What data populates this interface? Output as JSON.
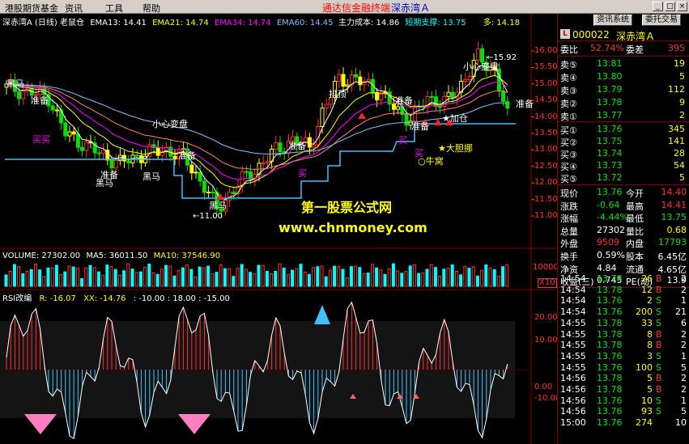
{
  "menu": {
    "items": [
      "港股期货基金",
      "资讯",
      "工具",
      "帮助"
    ],
    "ad": "通达信金融终端",
    "stock_title": "深赤湾Ａ"
  },
  "colors": {
    "up": "#ff3030",
    "down": "#00e000",
    "bg": "#000000",
    "grid": "#800000"
  },
  "main_header": {
    "name": "深赤湾A (日线) 老鼠仓",
    "ema13": "EMA13: 14.41",
    "ema21": "EMA21: 14.74",
    "ema34": "EMA34: 14.74",
    "ema60": "EMA60: 14.45",
    "cost": "主力成本: 14.86",
    "support": "短期支撑: 13.75",
    "duo": "多: 14.18"
  },
  "price_axis": [
    "16.00",
    "15.50",
    "15.00",
    "14.50",
    "14.00",
    "13.50",
    "13.00",
    "12.50",
    "12.00",
    "11.50",
    "11.00"
  ],
  "annotations": {
    "heima1": "黑马",
    "zhunbei1": "准备",
    "maimai": "买买",
    "zhunbei2": "准备",
    "heima2": "黑马",
    "heima3": "黑马",
    "xiaoxin1": "小心变盘",
    "zhunbei3": "准备",
    "heima4": "黑马",
    "low": "11.00",
    "mai1": "买",
    "zhunbei4": "准备",
    "douding": "抖顶",
    "zhunbei5": "准备",
    "mai2": "买",
    "zhunbei6": "准备",
    "jiacang": "加仓",
    "mai3": "买",
    "niuwo": "牛窝",
    "dadan": "大胆挪",
    "xiaoxin2": "小心变盘",
    "high": "15.92",
    "zhunbei7": "准备",
    "watermark1": "第一股票公式网",
    "watermark2": "www.chnmoney.com"
  },
  "volume_header": {
    "vol": "VOLUME: 27302.00",
    "ma5": "MA5: 36011.50",
    "ma10": "MA10: 37546.90"
  },
  "volume_axis": {
    "top": "10000",
    "unit": "X10"
  },
  "rsi_header": {
    "name": "RSI改编",
    "r": "R: -16.07",
    "xx": "XX: -14.76",
    "params": ": -10.00 : 18.00 : -15.00"
  },
  "rsi_axis": [
    "20.00",
    "10.00",
    "0.00",
    "-10.00"
  ],
  "right_panel": {
    "buttons": [
      "资讯系统",
      "委托交易"
    ],
    "code": "000022",
    "name": "深赤湾Ａ",
    "wb_label": "委比",
    "wb_value": "52.74%",
    "wc_label": "委差",
    "wc_value": "395",
    "asks": [
      {
        "label": "卖⑤",
        "price": "13.81",
        "vol": "19"
      },
      {
        "label": "卖④",
        "price": "13.80",
        "vol": "5"
      },
      {
        "label": "卖③",
        "price": "13.79",
        "vol": "112"
      },
      {
        "label": "卖②",
        "price": "13.78",
        "vol": "9"
      },
      {
        "label": "卖①",
        "price": "13.77",
        "vol": "2"
      }
    ],
    "bids": [
      {
        "label": "买①",
        "price": "13.76",
        "vol": "345"
      },
      {
        "label": "买②",
        "price": "13.75",
        "vol": "141"
      },
      {
        "label": "买③",
        "price": "13.74",
        "vol": "28"
      },
      {
        "label": "买④",
        "price": "13.73",
        "vol": "54"
      },
      {
        "label": "买⑤",
        "price": "13.72",
        "vol": "5"
      }
    ],
    "stats": [
      {
        "l1": "现价",
        "v1": "13.76",
        "l2": "今开",
        "v2": "14.40",
        "c1": "g",
        "c2": "r"
      },
      {
        "l1": "涨跌",
        "v1": "-0.64",
        "l2": "最高",
        "v2": "14.41",
        "c1": "g",
        "c2": "r"
      },
      {
        "l1": "涨幅",
        "v1": "-4.44%",
        "l2": "最低",
        "v2": "13.75",
        "c1": "g",
        "c2": "g"
      },
      {
        "l1": "总量",
        "v1": "27302",
        "l2": "量比",
        "v2": "0.68",
        "c1": "w",
        "c2": "y"
      },
      {
        "l1": "外盘",
        "v1": "9509",
        "l2": "内盘",
        "v2": "17793",
        "c1": "r",
        "c2": "g"
      },
      {
        "l1": "换手",
        "v1": "0.59%",
        "l2": "股本",
        "v2": "6.45亿",
        "c1": "w",
        "c2": "w"
      },
      {
        "l1": "净资",
        "v1": "4.84",
        "l2": "流通",
        "v2": "4.65亿",
        "c1": "w",
        "c2": "w"
      },
      {
        "l1": "收益(三)",
        "v1": "0.745",
        "l2": "PE(动)",
        "v2": "13.9",
        "c1": "w",
        "c2": "w"
      }
    ],
    "ticks": [
      {
        "t": "14:54",
        "p": "13.78",
        "v": "26",
        "s": "B",
        "n": "2"
      },
      {
        "t": "14:54",
        "p": "13.78",
        "v": "12",
        "s": "B",
        "n": "2"
      },
      {
        "t": "14:54",
        "p": "13.76",
        "v": "2",
        "s": "S",
        "n": "1"
      },
      {
        "t": "14:54",
        "p": "13.76",
        "v": "200",
        "s": "S",
        "n": "21"
      },
      {
        "t": "14:55",
        "p": "13.78",
        "v": "33",
        "s": "S",
        "n": "6"
      },
      {
        "t": "14:55",
        "p": "13.78",
        "v": "8",
        "s": "B",
        "n": "2"
      },
      {
        "t": "14:55",
        "p": "13.78",
        "v": "8",
        "s": "B",
        "n": "2"
      },
      {
        "t": "14:55",
        "p": "13.76",
        "v": "3",
        "s": "S",
        "n": "1"
      },
      {
        "t": "14:55",
        "p": "13.76",
        "v": "100",
        "s": "S",
        "n": "5"
      },
      {
        "t": "14:56",
        "p": "13.78",
        "v": "5",
        "s": "B",
        "n": "2"
      },
      {
        "t": "14:56",
        "p": "13.78",
        "v": "5",
        "s": "B",
        "n": "2"
      },
      {
        "t": "14:56",
        "p": "13.76",
        "v": "10",
        "s": "S",
        "n": "1"
      },
      {
        "t": "14:56",
        "p": "13.76",
        "v": "93",
        "s": "S",
        "n": "5"
      },
      {
        "t": "15:00",
        "p": "13.76",
        "v": "274",
        "s": "",
        "n": "10"
      }
    ]
  }
}
